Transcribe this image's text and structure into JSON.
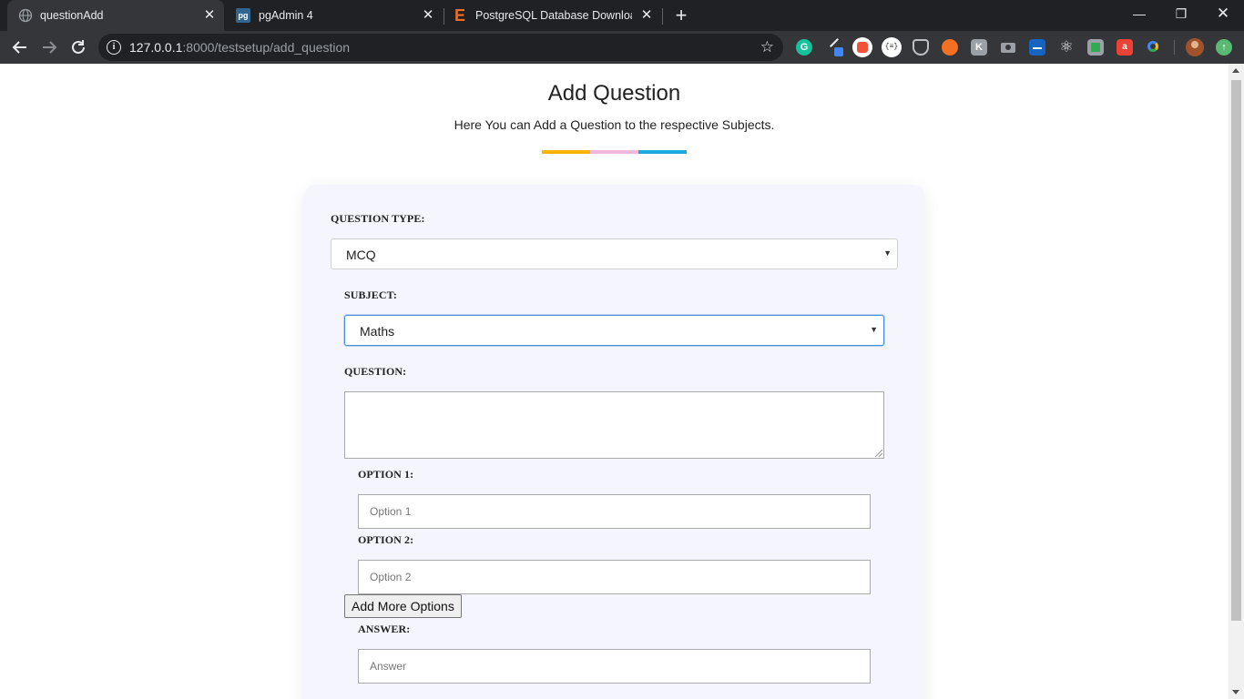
{
  "browser": {
    "tabs": [
      {
        "title": "questionAdd",
        "active": true
      },
      {
        "title": "pgAdmin 4",
        "active": false
      },
      {
        "title": "PostgreSQL Database Download",
        "active": false
      }
    ],
    "url_host": "127.0.0.1",
    "url_rest": ":8000/testsetup/add_question"
  },
  "page": {
    "title": "Add Question",
    "subtitle": "Here You can Add a Question to the respective Subjects.",
    "accent_colors": [
      "#f7b500",
      "#f2b8dc",
      "#1ba9e1"
    ]
  },
  "form": {
    "question_type_label": "QUESTION TYPE:",
    "question_type_value": "MCQ",
    "subject_label": "SUBJECT:",
    "subject_value": "Maths",
    "question_label": "QUESTION:",
    "option1_label": "OPTION 1:",
    "option1_placeholder": "Option 1",
    "option2_label": "OPTION 2:",
    "option2_placeholder": "Option 2",
    "add_more_label": "Add More Options",
    "answer_label": "ANSWER:",
    "answer_placeholder": "Answer"
  }
}
